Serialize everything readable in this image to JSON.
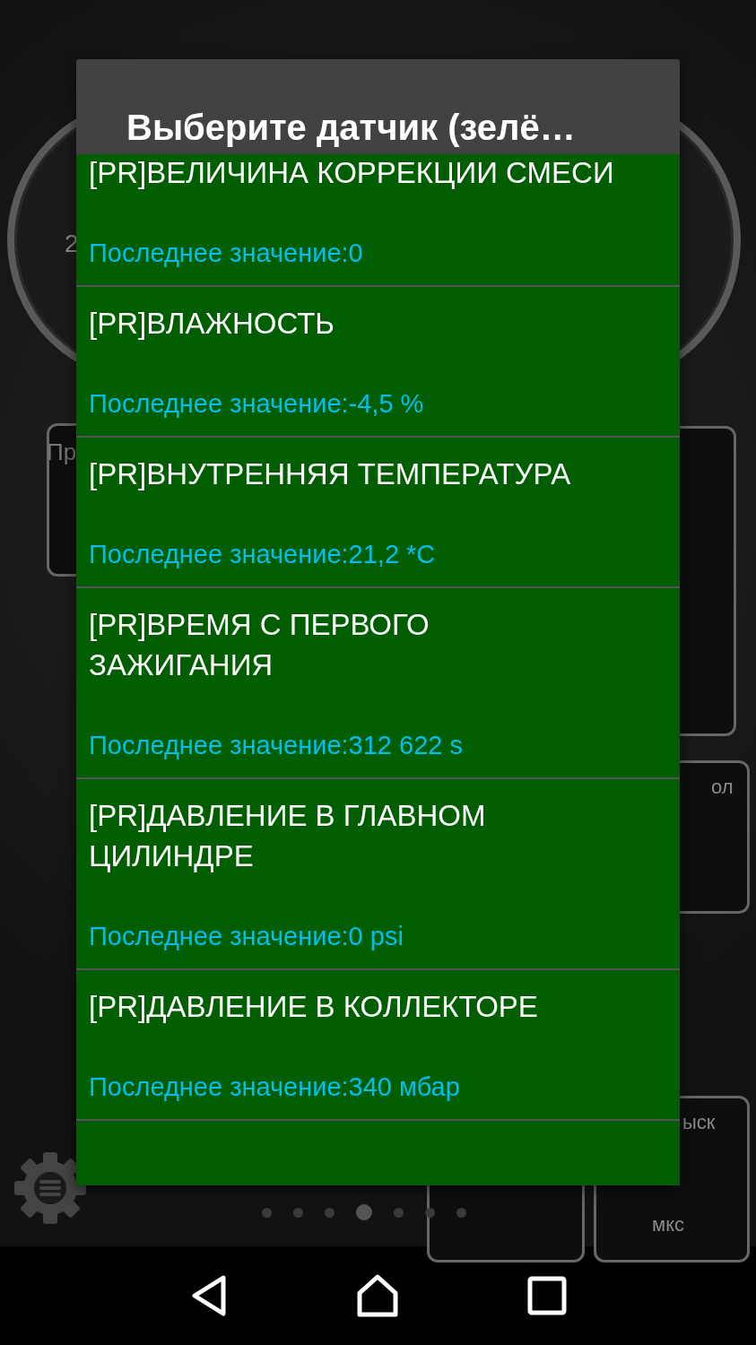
{
  "background": {
    "gauge_left_label": "2",
    "panel_left_label": "Пр",
    "panel_right_top_label": "ол",
    "panel_right_bottom_label": "ыск",
    "panel_right_bottom_unit": "мкс"
  },
  "page_indicator": [
    {
      "selected": false
    },
    {
      "selected": false
    },
    {
      "selected": false
    },
    {
      "selected": true
    },
    {
      "selected": false
    },
    {
      "selected": false
    },
    {
      "selected": false
    }
  ],
  "dialog": {
    "title": "Выберите датчик (зелё…",
    "items": [
      {
        "name": "[PR]ВЕЛИЧИНА КОРРЕКЦИИ СМЕСИ",
        "value": "Последнее значение:0"
      },
      {
        "name": "[PR]ВЛАЖНОСТЬ",
        "value": "Последнее значение:-4,5 %"
      },
      {
        "name": "[PR]ВНУТРЕННЯЯ ТЕМПЕРАТУРА",
        "value": "Последнее значение:21,2 *C"
      },
      {
        "name": "[PR]ВРЕМЯ С ПЕРВОГО ЗАЖИГАНИЯ",
        "value": "Последнее значение:312 622 s"
      },
      {
        "name": "[PR]ДАВЛЕНИЕ В ГЛАВНОМ ЦИЛИНДРЕ",
        "value": "Последнее значение:0 psi"
      },
      {
        "name": "[PR]ДАВЛЕНИЕ В КОЛЛЕКТОРЕ",
        "value": "Последнее значение:340 мбар"
      }
    ]
  }
}
